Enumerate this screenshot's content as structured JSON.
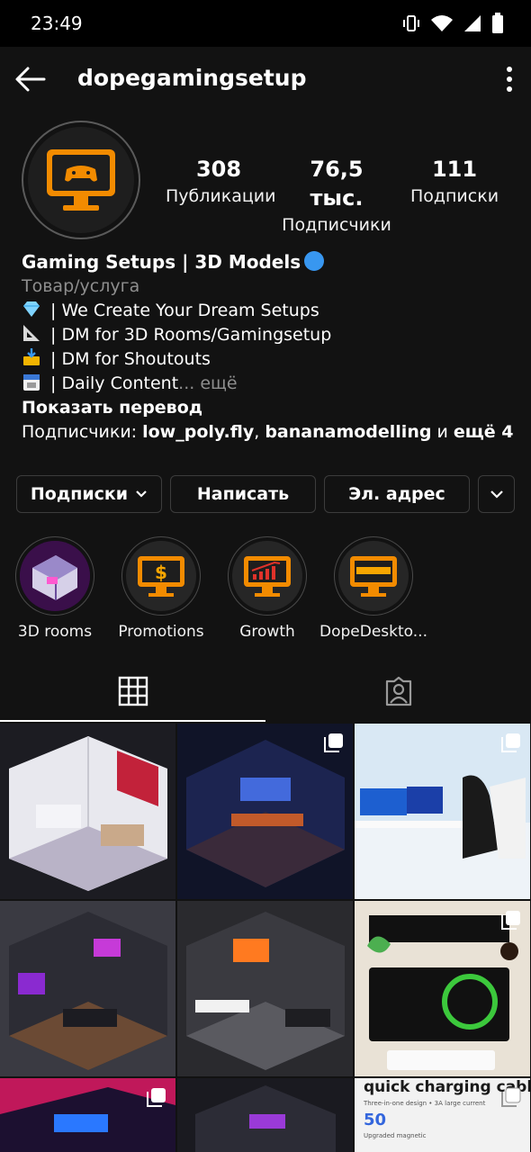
{
  "status_bar": {
    "time": "23:49"
  },
  "header": {
    "username": "dopegamingsetup"
  },
  "stats": [
    {
      "value": "308",
      "label": "Публикации"
    },
    {
      "value": "76,5 тыс.",
      "label": "Подписчики"
    },
    {
      "value": "111",
      "label": "Подписки"
    }
  ],
  "bio": {
    "name": "Gaming Setups | 3D Models",
    "category": "Товар/услуга",
    "lines": [
      " | We Create Your Dream Setups",
      " | DM for 3D Rooms/Gamingsetup",
      " | DM for Shoutouts",
      " | Daily Content"
    ],
    "more": "... ещё",
    "translate": "Показать перевод",
    "followers_prefix": "Подписчики: ",
    "follower_1": "low_poly.fly",
    "sep": ", ",
    "follower_2": "bananamodelling",
    "and": " и ",
    "more_followers": "ещё 4"
  },
  "buttons": {
    "following": "Подписки",
    "message": "Написать",
    "email": "Эл. адрес"
  },
  "highlights": [
    {
      "label": "3D rooms"
    },
    {
      "label": "Promotions"
    },
    {
      "label": "Growth"
    },
    {
      "label": "DopeDeskto..."
    }
  ],
  "grid_text": {
    "quick_charging": "quick charging cable",
    "sub1": "Three-in-one design • 3A large current",
    "big": "50",
    "sub2": "Upgraded magnetic"
  },
  "colors": {
    "accent": "#f7a600",
    "monitor_orange": "#f28b00",
    "background": "#121212"
  }
}
